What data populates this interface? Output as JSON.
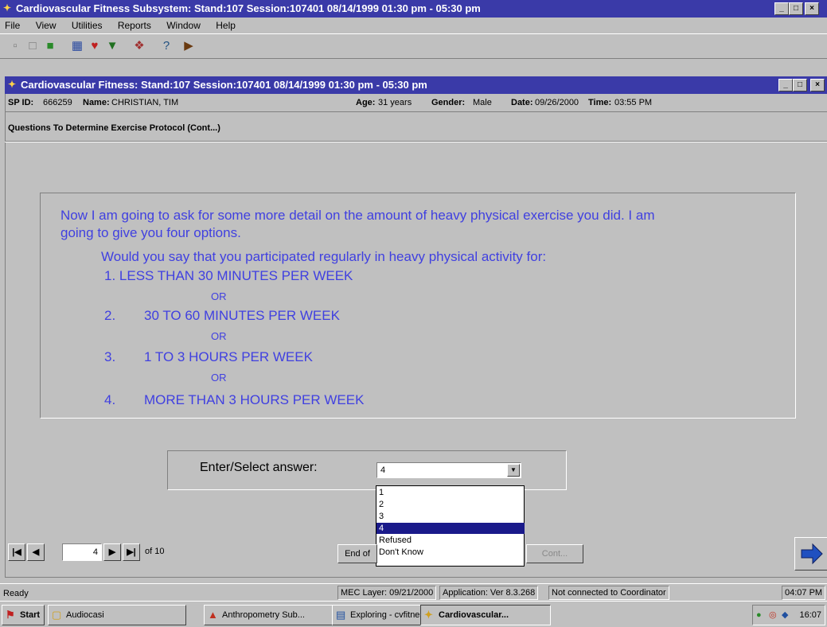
{
  "app": {
    "title": "Cardiovascular Fitness Subsystem: Stand:107 Session:107401 08/14/1999 01:30 pm - 05:30 pm",
    "window_buttons": [
      "_",
      "□",
      "×"
    ]
  },
  "menu": [
    "File",
    "View",
    "Utilities",
    "Reports",
    "Window",
    "Help"
  ],
  "toolbar_icons": [
    "open-icon",
    "new-icon",
    "save-icon",
    "network-icon",
    "heart-icon",
    "filter-icon",
    "tools-icon",
    "help-icon",
    "exit-icon"
  ],
  "child": {
    "title": "Cardiovascular Fitness: Stand:107 Session:107401 08/14/1999 01:30 pm - 05:30 pm",
    "sp_id_label": "SP ID:",
    "sp_id": "666259",
    "name_label": "Name:",
    "name": "CHRISTIAN, TIM",
    "age_label": "Age:",
    "age": "31 years",
    "gender_label": "Gender:",
    "gender": "Male",
    "date_label": "Date:",
    "date": "09/26/2000",
    "time_label": "Time:",
    "time": "03:55 PM",
    "section": "Questions To Determine Exercise Protocol (Cont...)"
  },
  "question": {
    "line1": "Now I am going to ask for some more detail on the amount of heavy physical exercise you did. I am",
    "line2": "going to give you four options.",
    "line3": "Would you say that you participated regularly in heavy physical activity for:",
    "opt1": "1.  LESS THAN 30 MINUTES PER WEEK",
    "or1": "OR",
    "opt2_num": "2.",
    "opt2": "30 TO 60 MINUTES PER WEEK",
    "or2": "OR",
    "opt3_num": "3.",
    "opt3": "1 TO 3 HOURS PER WEEK",
    "or3": "OR",
    "opt4_num": "4.",
    "opt4": "MORE THAN 3 HOURS PER WEEK"
  },
  "answer": {
    "label": "Enter/Select answer:",
    "value": "4",
    "options": [
      "1",
      "2",
      "3",
      "4",
      "Refused",
      "Don't Know"
    ],
    "selected_index": 3
  },
  "nav": {
    "page": "4",
    "of": "of 10",
    "end_label": "End of",
    "disabled_label": "Cont..."
  },
  "status": {
    "ready": "Ready",
    "mec": "MEC Layer: 09/21/2000",
    "app": "Application: Ver 8.3.268",
    "conn": "Not connected to Coordinator",
    "clock": "04:07 PM"
  },
  "taskbar": {
    "start": "Start",
    "tasks": [
      "Audiocasi",
      "Anthropometry Sub...",
      "Exploring - cvfitness",
      "Cardiovascular..."
    ],
    "tray_time": "16:07"
  },
  "colors": {
    "title_bg": "#3a3aa8",
    "question_text": "#4040e0",
    "face": "#c0c0c0",
    "selected": "#1a1a8a"
  }
}
